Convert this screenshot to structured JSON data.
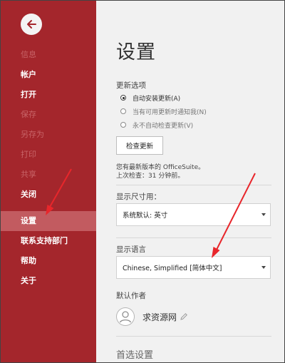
{
  "sidebar": {
    "items": [
      {
        "label": "信息",
        "state": "disabled"
      },
      {
        "label": "帐户",
        "state": "normal"
      },
      {
        "label": "打开",
        "state": "normal"
      },
      {
        "label": "保存",
        "state": "disabled"
      },
      {
        "label": "另存为",
        "state": "disabled"
      },
      {
        "label": "打印",
        "state": "disabled"
      },
      {
        "label": "共享",
        "state": "disabled"
      },
      {
        "label": "关闭",
        "state": "normal"
      },
      {
        "label": "设置",
        "state": "active"
      },
      {
        "label": "联系支持部门",
        "state": "normal"
      },
      {
        "label": "帮助",
        "state": "normal"
      },
      {
        "label": "关于",
        "state": "normal"
      }
    ]
  },
  "main": {
    "title": "设置",
    "update": {
      "section_label": "更新选项",
      "options": [
        {
          "label": "自动安装更新(A)",
          "checked": true
        },
        {
          "label": "当有可用更新时通知我(N)",
          "checked": false
        },
        {
          "label": "永不自动检查更新(V)",
          "checked": false
        }
      ],
      "check_button": "检查更新",
      "status_line1": "您有最新版本的 OfficeSuite。",
      "status_line2": "上次检查：31 分钟前。"
    },
    "units": {
      "section_label": "显示尺寸用：",
      "value": "系统默认: 英寸"
    },
    "language": {
      "section_label": "显示语言",
      "value": "Chinese, Simplified [简体中文]"
    },
    "author": {
      "section_label": "默认作者",
      "name": "求资源网"
    },
    "preferences": {
      "title": "首选设置"
    }
  },
  "colors": {
    "sidebar_bg": "#a4262c",
    "sidebar_active": "#c25b60",
    "arrow_red": "#e8262b"
  }
}
